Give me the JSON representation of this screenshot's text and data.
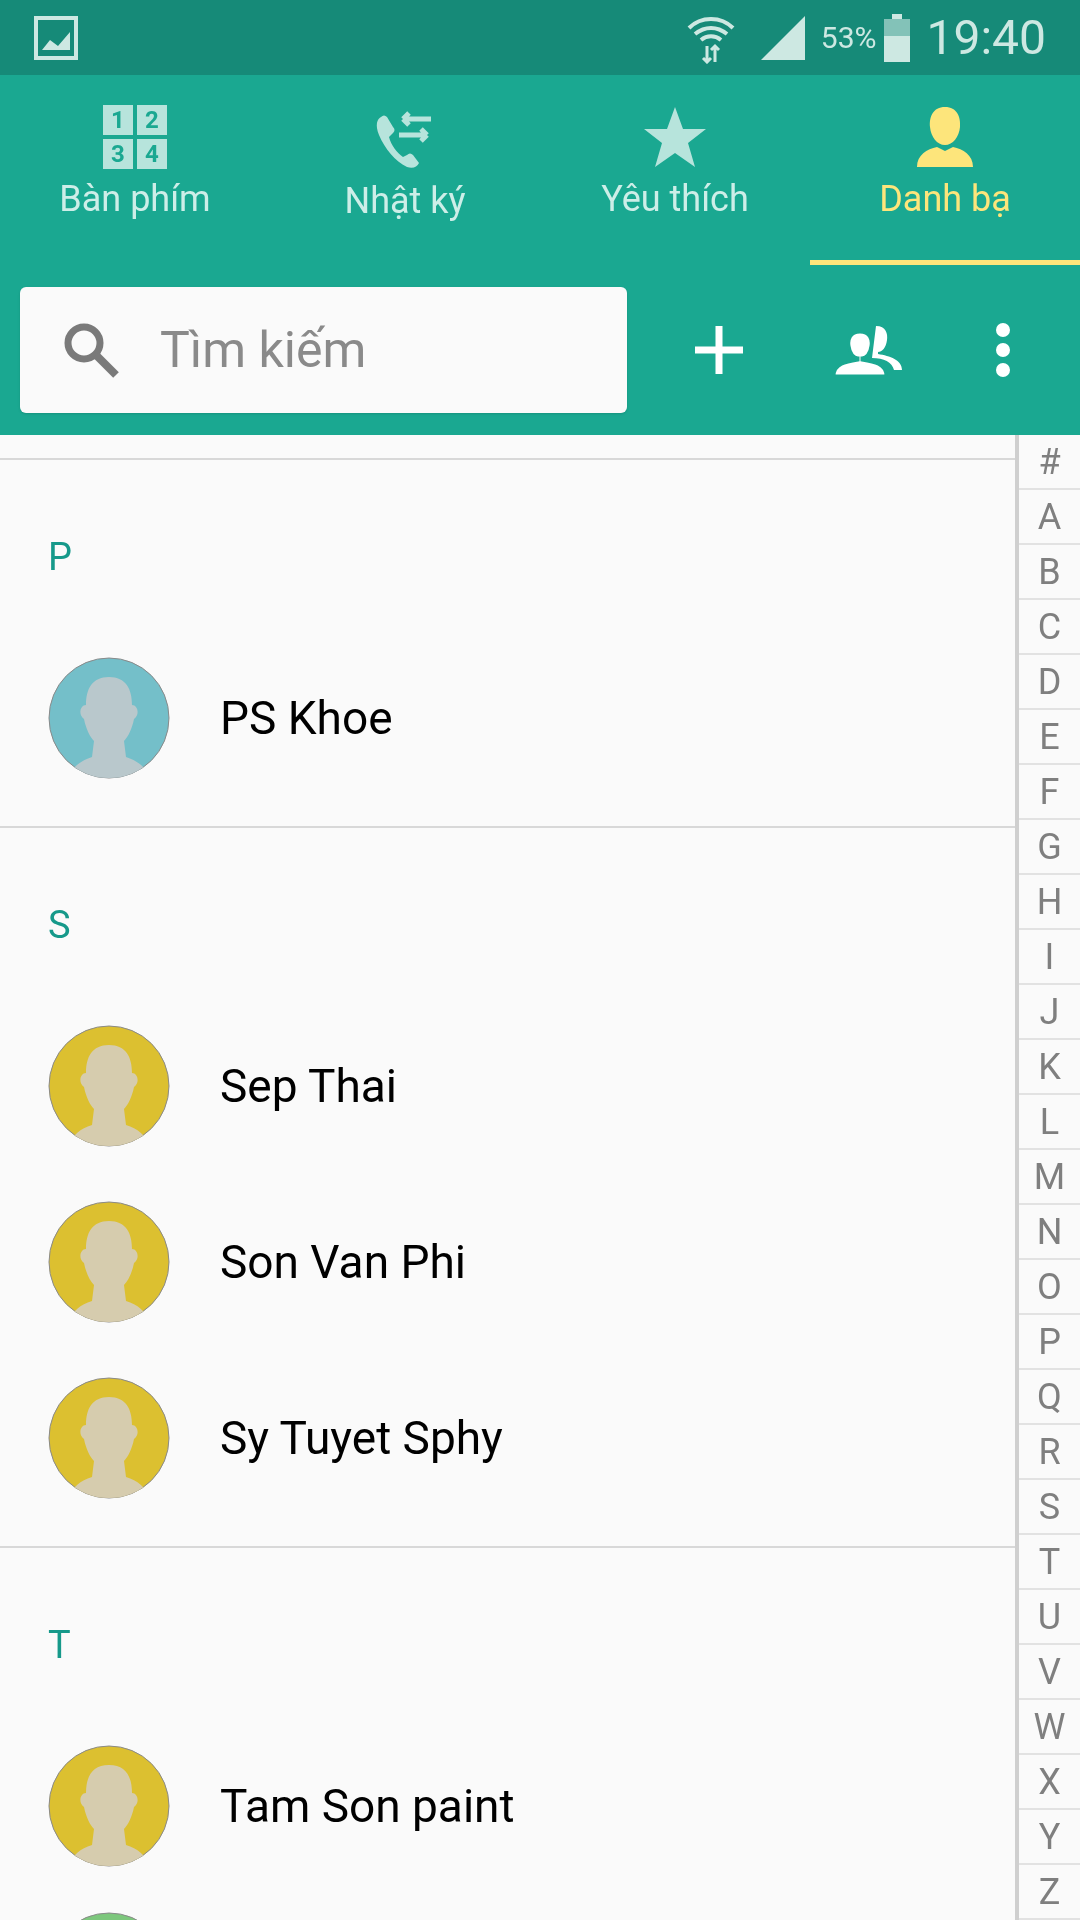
{
  "status_bar": {
    "battery": "53%",
    "time": "19:40"
  },
  "tabs": [
    {
      "kind": "keypad",
      "label": "Bàn phím",
      "icon_digits": [
        "1",
        "2",
        "3",
        "4"
      ],
      "selected": false
    },
    {
      "kind": "log",
      "label": "Nhật ký",
      "selected": false
    },
    {
      "kind": "favorites",
      "label": "Yêu thích",
      "selected": false
    },
    {
      "kind": "contacts",
      "label": "Danh bạ",
      "selected": true
    }
  ],
  "search": {
    "placeholder": "Tìm kiếm"
  },
  "sections": [
    {
      "letter": "P",
      "contacts": [
        {
          "name": "PS Khoe",
          "color": "#74bfc9"
        }
      ]
    },
    {
      "letter": "S",
      "contacts": [
        {
          "name": "Sep Thai",
          "color": "#dcc030"
        },
        {
          "name": "Son Van Phi",
          "color": "#dcc030"
        },
        {
          "name": "Sy Tuyet Sphy",
          "color": "#dcc030"
        }
      ]
    },
    {
      "letter": "T",
      "contacts": [
        {
          "name": "Tam Son paint",
          "color": "#dcc030"
        },
        {
          "color": "#7cc77c"
        }
      ]
    }
  ],
  "index": [
    "#",
    "A",
    "B",
    "C",
    "D",
    "E",
    "F",
    "G",
    "H",
    "I",
    "J",
    "K",
    "L",
    "M",
    "N",
    "O",
    "P",
    "Q",
    "R",
    "S",
    "T",
    "U",
    "V",
    "W",
    "X",
    "Y",
    "Z"
  ]
}
